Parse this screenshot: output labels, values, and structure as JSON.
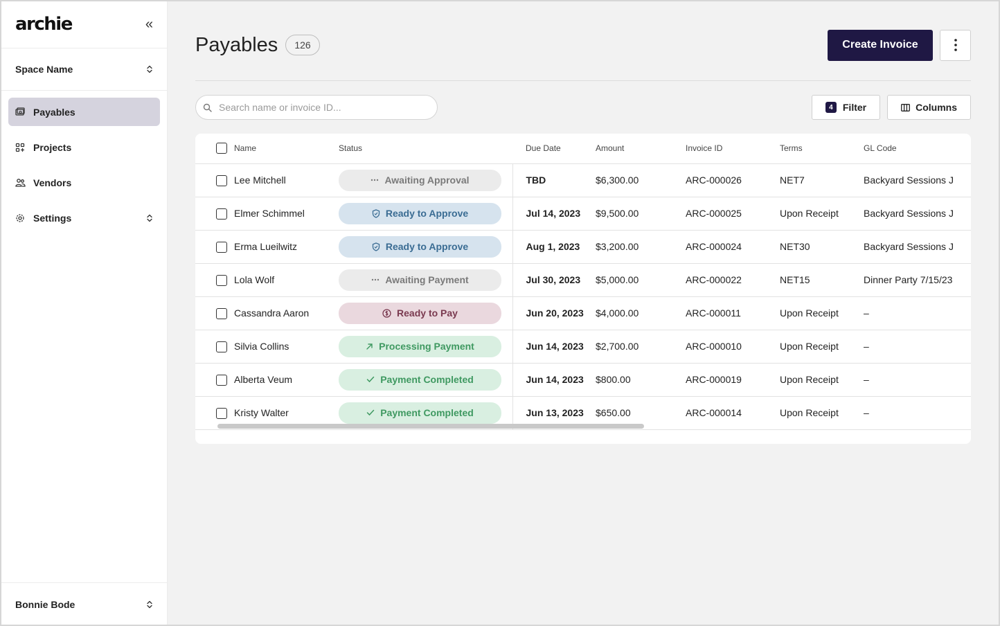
{
  "sidebar": {
    "logo": "archie",
    "space_name": "Space Name",
    "items": [
      {
        "label": "Payables",
        "icon": "payables-icon"
      },
      {
        "label": "Projects",
        "icon": "projects-icon"
      },
      {
        "label": "Vendors",
        "icon": "vendors-icon"
      },
      {
        "label": "Settings",
        "icon": "gear-icon"
      }
    ],
    "user_name": "Bonnie Bode"
  },
  "header": {
    "title": "Payables",
    "count": "126",
    "create_label": "Create Invoice"
  },
  "toolbar": {
    "search_placeholder": "Search name or invoice ID...",
    "filter_count": "4",
    "filter_label": "Filter",
    "columns_label": "Columns"
  },
  "table": {
    "columns": [
      "Name",
      "Status",
      "Due Date",
      "Amount",
      "Invoice ID",
      "Terms",
      "GL Code"
    ],
    "rows": [
      {
        "name": "Lee Mitchell",
        "status": "Awaiting Approval",
        "due": "TBD",
        "amount": "$6,300.00",
        "invoice": "ARC-000026",
        "terms": "NET7",
        "gl": "Backyard Sessions J"
      },
      {
        "name": "Elmer Schimmel",
        "status": "Ready to Approve",
        "due": "Jul 14, 2023",
        "amount": "$9,500.00",
        "invoice": "ARC-000025",
        "terms": "Upon Receipt",
        "gl": "Backyard Sessions J"
      },
      {
        "name": "Erma Lueilwitz",
        "status": "Ready to Approve",
        "due": "Aug 1, 2023",
        "amount": "$3,200.00",
        "invoice": "ARC-000024",
        "terms": "NET30",
        "gl": "Backyard Sessions J"
      },
      {
        "name": "Lola Wolf",
        "status": "Awaiting Payment",
        "due": "Jul 30, 2023",
        "amount": "$5,000.00",
        "invoice": "ARC-000022",
        "terms": "NET15",
        "gl": "Dinner Party 7/15/23"
      },
      {
        "name": "Cassandra Aaron",
        "status": "Ready to Pay",
        "due": "Jun 20, 2023",
        "amount": "$4,000.00",
        "invoice": "ARC-000011",
        "terms": "Upon Receipt",
        "gl": "–"
      },
      {
        "name": "Silvia Collins",
        "status": "Processing Payment",
        "due": "Jun 14, 2023",
        "amount": "$2,700.00",
        "invoice": "ARC-000010",
        "terms": "Upon Receipt",
        "gl": "–"
      },
      {
        "name": "Alberta Veum",
        "status": "Payment Completed",
        "due": "Jun 14, 2023",
        "amount": "$800.00",
        "invoice": "ARC-000019",
        "terms": "Upon Receipt",
        "gl": "–"
      },
      {
        "name": "Kristy Walter",
        "status": "Payment Completed",
        "due": "Jun 13, 2023",
        "amount": "$650.00",
        "invoice": "ARC-000014",
        "terms": "Upon Receipt",
        "gl": "–"
      }
    ]
  },
  "status_styles": {
    "Awaiting Approval": {
      "class": "p-gray",
      "icon": "ellipsis-icon"
    },
    "Awaiting Payment": {
      "class": "p-gray",
      "icon": "ellipsis-icon"
    },
    "Ready to Approve": {
      "class": "p-blue",
      "icon": "shield-icon"
    },
    "Ready to Pay": {
      "class": "p-rose",
      "icon": "dollar-circle-icon"
    },
    "Processing Payment": {
      "class": "p-green",
      "icon": "arrow-up-right-icon"
    },
    "Payment Completed": {
      "class": "p-green",
      "icon": "check-icon"
    }
  },
  "colors": {
    "primary": "#1f1844",
    "active_nav": "#d5d3de",
    "background": "#f2f2f2"
  }
}
